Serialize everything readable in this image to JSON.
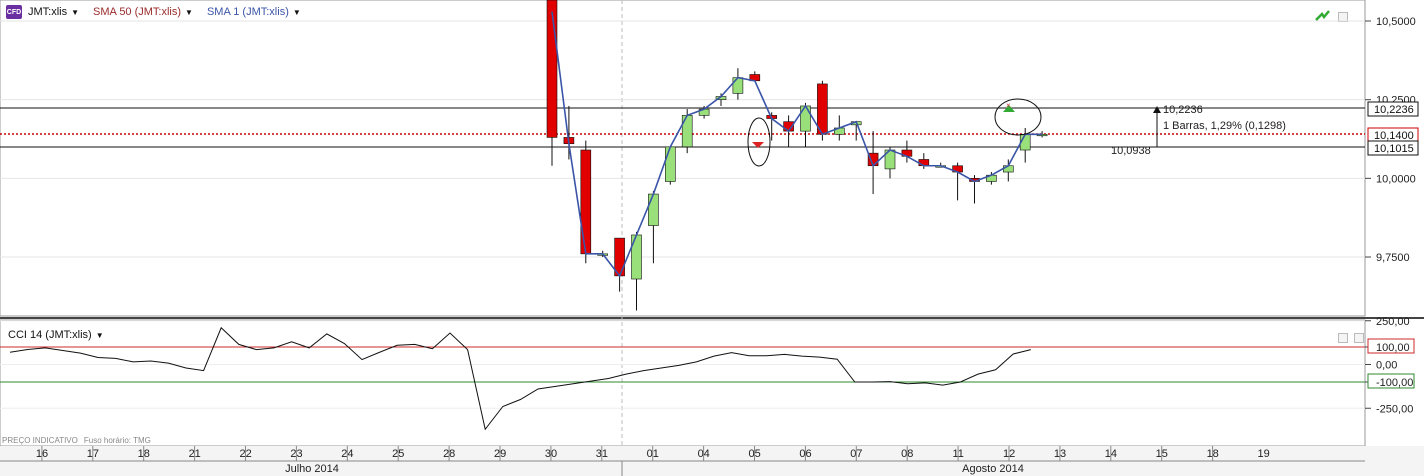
{
  "header": {
    "symbol": "JMT:xlis",
    "indicator1": "SMA 50 (JMT:xlis)",
    "indicator2": "SMA 1 (JMT:xlis)",
    "badge": "CFD"
  },
  "cci_panel": {
    "label": "CCI 14 (JMT:xlis)"
  },
  "footer": {
    "price_note": "PREÇO INDICATIVO",
    "timezone": "Fuso horário: TMG"
  },
  "annotations": {
    "measure_top": "10,2236",
    "measure_text": "1 Barras, 1,29% (0,1298)",
    "measure_bottom": "10,0938"
  },
  "price_axis_labels": {
    "current": "10,1400",
    "level_high": "10,2236",
    "level_low": "10,1015"
  },
  "colors": {
    "up": "#99e07a",
    "down": "#e00000",
    "sma": "#3a55a8",
    "cci_upper": "#cc2a2a",
    "cci_lower": "#2f8a2f",
    "current_line": "#cc0000"
  },
  "chart_data": [
    {
      "type": "candlestick",
      "title": "JMT:xlis",
      "ylim": [
        9.55,
        10.54
      ],
      "y_ticks": [
        "10,5000",
        "10,2500",
        "10,0000",
        "9,7500"
      ],
      "x_ticks": [
        "16",
        "17",
        "18",
        "21",
        "22",
        "23",
        "24",
        "25",
        "28",
        "29",
        "30",
        "31",
        "01",
        "04",
        "05",
        "06",
        "07",
        "08",
        "11",
        "12",
        "13",
        "14",
        "15",
        "18",
        "19"
      ],
      "months": [
        "Julho 2014",
        "Agosto 2014"
      ],
      "candles": [
        {
          "o": 11.0,
          "h": 11.1,
          "l": 10.04,
          "c": 10.13
        },
        {
          "o": 10.13,
          "h": 10.23,
          "l": 10.06,
          "c": 10.11
        },
        {
          "o": 10.09,
          "h": 10.12,
          "l": 9.73,
          "c": 9.76
        },
        {
          "o": 9.76,
          "h": 9.77,
          "l": 9.75,
          "c": 9.76
        },
        {
          "o": 9.81,
          "h": 9.81,
          "l": 9.64,
          "c": 9.69
        },
        {
          "o": 9.68,
          "h": 9.83,
          "l": 9.58,
          "c": 9.82
        },
        {
          "o": 9.85,
          "h": 9.96,
          "l": 9.73,
          "c": 9.95
        },
        {
          "o": 9.99,
          "h": 10.1,
          "l": 9.98,
          "c": 10.1
        },
        {
          "o": 10.1,
          "h": 10.22,
          "l": 10.08,
          "c": 10.2
        },
        {
          "o": 10.2,
          "h": 10.23,
          "l": 10.19,
          "c": 10.22
        },
        {
          "o": 10.25,
          "h": 10.27,
          "l": 10.23,
          "c": 10.26
        },
        {
          "o": 10.27,
          "h": 10.35,
          "l": 10.25,
          "c": 10.32
        },
        {
          "o": 10.33,
          "h": 10.34,
          "l": 10.31,
          "c": 10.31
        },
        {
          "o": 10.2,
          "h": 10.21,
          "l": 10.12,
          "c": 10.19
        },
        {
          "o": 10.18,
          "h": 10.2,
          "l": 10.1,
          "c": 10.15
        },
        {
          "o": 10.15,
          "h": 10.24,
          "l": 10.1,
          "c": 10.23
        },
        {
          "o": 10.3,
          "h": 10.31,
          "l": 10.12,
          "c": 10.14
        },
        {
          "o": 10.14,
          "h": 10.2,
          "l": 10.12,
          "c": 10.16
        },
        {
          "o": 10.17,
          "h": 10.18,
          "l": 10.12,
          "c": 10.18
        },
        {
          "o": 10.08,
          "h": 10.15,
          "l": 9.95,
          "c": 10.04
        },
        {
          "o": 10.03,
          "h": 10.1,
          "l": 10.0,
          "c": 10.09
        },
        {
          "o": 10.09,
          "h": 10.12,
          "l": 10.05,
          "c": 10.07
        },
        {
          "o": 10.06,
          "h": 10.08,
          "l": 10.03,
          "c": 10.04
        },
        {
          "o": 10.04,
          "h": 10.05,
          "l": 10.04,
          "c": 10.04
        },
        {
          "o": 10.04,
          "h": 10.05,
          "l": 9.93,
          "c": 10.02
        },
        {
          "o": 10.0,
          "h": 10.01,
          "l": 9.92,
          "c": 9.99
        },
        {
          "o": 9.99,
          "h": 10.02,
          "l": 9.98,
          "c": 10.01
        },
        {
          "o": 10.02,
          "h": 10.06,
          "l": 9.99,
          "c": 10.04
        },
        {
          "o": 10.09,
          "h": 10.16,
          "l": 10.05,
          "c": 10.14
        },
        {
          "o": 10.14,
          "h": 10.15,
          "l": 10.13,
          "c": 10.14
        }
      ],
      "sma1": [
        10.53,
        10.11,
        9.76,
        9.76,
        9.69,
        9.82,
        9.95,
        10.1,
        10.2,
        10.22,
        10.26,
        10.32,
        10.31,
        10.19,
        10.15,
        10.23,
        10.14,
        10.16,
        10.18,
        10.04,
        10.09,
        10.07,
        10.04,
        10.04,
        10.02,
        9.99,
        10.01,
        10.04,
        10.14,
        10.14
      ]
    },
    {
      "type": "line",
      "title": "CCI 14 (JMT:xlis)",
      "ylim": [
        -390,
        270
      ],
      "y_ticks": [
        "250,00",
        "100,00",
        "0,00",
        "-100,00",
        "-250,00"
      ],
      "levels": [
        100,
        -100
      ],
      "values": [
        70,
        86,
        95,
        80,
        65,
        40,
        35,
        15,
        20,
        8,
        -20,
        -35,
        210,
        115,
        85,
        95,
        130,
        95,
        175,
        120,
        28,
        70,
        110,
        115,
        90,
        180,
        85,
        -370,
        -240,
        -200,
        -140,
        -125,
        -110,
        -95,
        -80,
        -55,
        -35,
        -20,
        -5,
        15,
        48,
        68,
        50,
        50,
        58,
        48,
        42,
        30,
        -100,
        -100,
        -98,
        -110,
        -105,
        -118,
        -100,
        -55,
        -30,
        60,
        85
      ]
    }
  ]
}
